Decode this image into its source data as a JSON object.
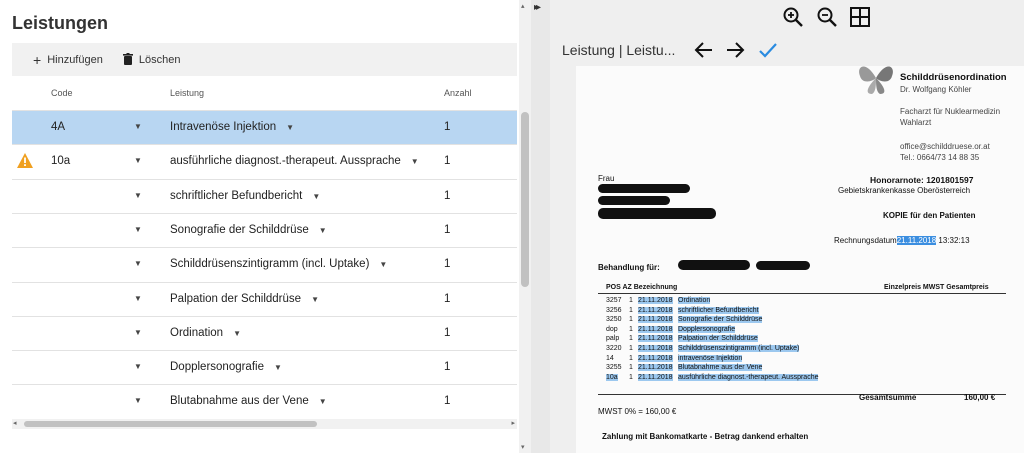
{
  "left": {
    "title": "Leistungen",
    "toolbar": {
      "add_label": "Hinzufügen",
      "delete_label": "Löschen"
    },
    "columns": {
      "code": "Code",
      "leistung": "Leistung",
      "anzahl": "Anzahl"
    },
    "rows": [
      {
        "code": "4A",
        "leistung": "Intravenöse Injektion",
        "anzahl": "1",
        "selected": true,
        "warning": false
      },
      {
        "code": "10a",
        "leistung": "ausführliche diagnost.-therapeut. Aussprache",
        "anzahl": "1",
        "selected": false,
        "warning": true
      },
      {
        "code": "",
        "leistung": "schriftlicher Befundbericht",
        "anzahl": "1",
        "selected": false,
        "warning": false
      },
      {
        "code": "",
        "leistung": "Sonografie der Schilddrüse",
        "anzahl": "1",
        "selected": false,
        "warning": false
      },
      {
        "code": "",
        "leistung": "Schilddrüsenszintigramm (incl. Uptake)",
        "anzahl": "1",
        "selected": false,
        "warning": false
      },
      {
        "code": "",
        "leistung": "Palpation der Schilddrüse",
        "anzahl": "1",
        "selected": false,
        "warning": false
      },
      {
        "code": "",
        "leistung": "Ordination",
        "anzahl": "1",
        "selected": false,
        "warning": false
      },
      {
        "code": "",
        "leistung": "Dopplersonografie",
        "anzahl": "1",
        "selected": false,
        "warning": false
      },
      {
        "code": "",
        "leistung": "Blutabnahme aus der Vene",
        "anzahl": "1",
        "selected": false,
        "warning": false
      }
    ]
  },
  "right": {
    "doc_title": "Leistung | Leistu...",
    "document": {
      "clinic_name": "Schilddrüsenordination",
      "doctor": "Dr. Wolfgang Köhler",
      "specialty_1": "Facharzt für Nuklearmedizin",
      "specialty_2": "Wahlarzt",
      "email": "office@schilddruese.or.at",
      "phone": "Tel.: 0664/73 14 88 35",
      "salutation": "Frau",
      "honorarnote": "Honorarnote: 1201801597",
      "kasse": "Gebietskrankenkasse Oberösterreich",
      "kopie": "KOPIE für den Patienten",
      "rechnungsdatum_label": "Rechnungsdatum",
      "rechnungsdatum_date": "21.11.2018",
      "rechnungsdatum_time": "13:32:13",
      "behandlung": "Behandlung für:",
      "table_header_left": "POS   AZ Bezeichnung",
      "table_header_right": "Einzelpreis MWST Gesamtpreis",
      "lines": [
        {
          "pos": "3257",
          "az": "1",
          "date": "21.11.2018",
          "text": "Ordination"
        },
        {
          "pos": "3256",
          "az": "1",
          "date": "21.11.2018",
          "text": "schriftlicher Befundbericht"
        },
        {
          "pos": "3250",
          "az": "1",
          "date": "21.11.2018",
          "text": "Sonografie der Schilddrüse"
        },
        {
          "pos": "dop",
          "az": "1",
          "date": "21.11.2018",
          "text": "Dopplersonografie"
        },
        {
          "pos": "palp",
          "az": "1",
          "date": "21.11.2018",
          "text": "Palpation der Schilddrüse"
        },
        {
          "pos": "3220",
          "az": "1",
          "date": "21.11.2018",
          "text": "Schilddrüsenszintigramm (incl. Uptake)"
        },
        {
          "pos": "14",
          "az": "1",
          "date": "21.11.2018",
          "text": "intravenöse Injektion"
        },
        {
          "pos": "3255",
          "az": "1",
          "date": "21.11.2018",
          "text": "Blutabnahme aus der Vene"
        },
        {
          "pos": "10a",
          "az": "1",
          "date": "21.11.2018",
          "text": "ausführliche diagnost.-therapeut. Aussprache"
        }
      ],
      "gesamtsumme_label": "Gesamtsumme",
      "gesamtsumme_value": "160,00 €",
      "mwst": "MWST 0% = 160,00 €",
      "zahlung": "Zahlung mit Bankomatkarte - Betrag dankend erhalten"
    }
  },
  "colors": {
    "selected_row": "#b8d6f2",
    "highlight": "#9cc8ef",
    "warning": "#f0a020",
    "confirm": "#2a8be0"
  },
  "icons": [
    "add-icon",
    "trash-icon",
    "warning-icon",
    "chevron-down-icon",
    "zoom-in-icon",
    "zoom-out-icon",
    "grid-icon",
    "arrow-left-icon",
    "arrow-right-icon",
    "check-icon",
    "double-chevron-right-icon"
  ]
}
